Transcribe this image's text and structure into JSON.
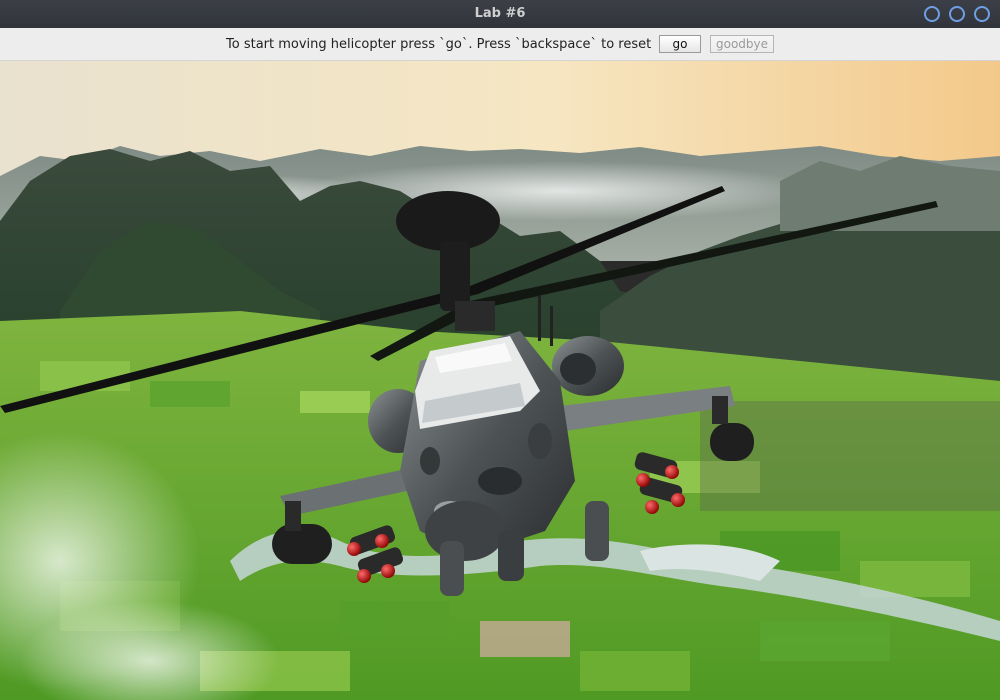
{
  "window": {
    "title": "Lab #6"
  },
  "toolbar": {
    "instructions": "To start moving helicopter press `go`. Press `backspace` to reset",
    "go_label": "go",
    "goodbye_label": "goodbye"
  },
  "colors": {
    "titlebar": "#33363d",
    "window_button_ring": "#6e9fe6",
    "sky": "#f3d9a2",
    "field_green": "#6fae2e",
    "helicopter_body": "#5a5e60"
  }
}
